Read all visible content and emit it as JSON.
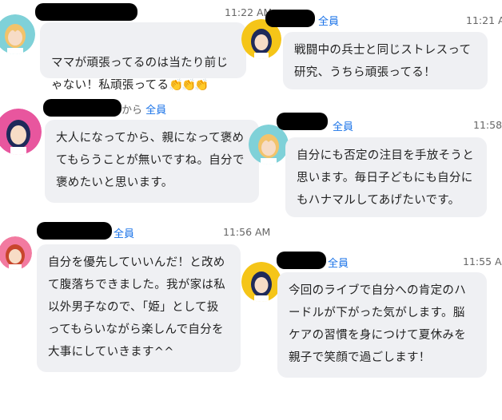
{
  "messages": [
    {
      "id": "m1",
      "recipient": "",
      "prefix": "",
      "time": "11:22 AM",
      "text": "ママが頑張ってるのは当たり前じゃない！私頑張ってる",
      "emoji": "👏👏👏",
      "avatar": "avatar-blonde-teal"
    },
    {
      "id": "m2",
      "recipient": "全員",
      "prefix": "",
      "time": "11:21 A",
      "text": "戦闘中の兵士と同じストレスって研究、うちら頑張ってる！",
      "avatar": "avatar-darkhair-yellow"
    },
    {
      "id": "m3",
      "recipient": "全員",
      "prefix": "から",
      "time": "",
      "text": "大人になってから、親になって褒めてもらうことが無いですね。自分で褒めたいと思います。",
      "avatar": "avatar-darkhair-pink"
    },
    {
      "id": "m4",
      "recipient": "全員",
      "prefix": "",
      "time": "11:58",
      "text": "自分にも否定の注目を手放そうと思います。毎日子どもにも自分にもハナマルしてあげたいです。",
      "avatar": "avatar-blonde-teal"
    },
    {
      "id": "m5",
      "recipient": "全員",
      "prefix": "",
      "time": "11:56 AM",
      "text": "自分を優先していいんだ！と改めて腹落ちできました。我が家は私以外男子なので、「姫」として扱ってもらいながら楽しんで自分を大事にしていきます^^",
      "avatar": "avatar-redhair-pink"
    },
    {
      "id": "m6",
      "recipient": "全員",
      "prefix": "",
      "time": "11:55 A",
      "text": "今回のライブで自分への肯定のハードルが下がった気がします。脳ケアの習慣を身につけて夏休みを親子で笑顔で過ごします！",
      "avatar": "avatar-darkhair-yellow"
    }
  ],
  "colors": {
    "bubble": "#eff0f3",
    "recipient": "#1a73e8",
    "redaction": "#000000"
  }
}
